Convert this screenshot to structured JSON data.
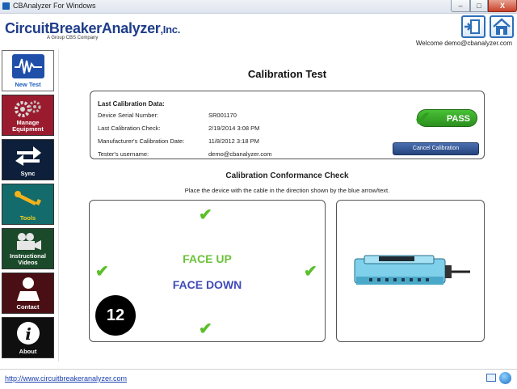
{
  "window": {
    "title": "CBAnalyzer For Windows",
    "minimize": "–",
    "maximize": "□",
    "close": "X"
  },
  "header": {
    "logo_main": "CircuitBreakerAnalyzer",
    "logo_suffix": ",Inc.",
    "tagline": "A Group CBS Company",
    "welcome": "Welcome demo@cbanalyzer.com",
    "exit_icon": "exit-door-icon",
    "home_icon": "home-icon"
  },
  "sidebar": {
    "items": [
      {
        "label": "New Test",
        "icon": "waveform-icon",
        "bg": "#ffffff",
        "fg": "#1f5fbf",
        "active": true
      },
      {
        "label": "Manage Equipment",
        "icon": "gears-icon",
        "bg": "#9b1b2e",
        "fg": "#ffffff"
      },
      {
        "label": "Sync",
        "icon": "sync-arrows-icon",
        "bg": "#0d1f3a",
        "fg": "#ffffff"
      },
      {
        "label": "Tools",
        "icon": "wrench-icon",
        "bg": "#146b6b",
        "fg": "#f2d21b"
      },
      {
        "label": "Instructional Videos",
        "icon": "video-camera-icon",
        "bg": "#1b4a2a",
        "fg": "#ffffff"
      },
      {
        "label": "Contact",
        "icon": "person-icon",
        "bg": "#4a0f14",
        "fg": "#ffffff"
      },
      {
        "label": "About",
        "icon": "info-icon",
        "bg": "#0f0f0f",
        "fg": "#ffffff"
      }
    ]
  },
  "main": {
    "title": "Calibration Test",
    "last_calibration": {
      "heading": "Last Calibration Data:",
      "rows": [
        {
          "label": "Device Serial Number:",
          "value": "SR001170"
        },
        {
          "label": "Last Calibration Check:",
          "value": "2/19/2014 3:08 PM"
        },
        {
          "label": "Manufacturer's Calibration Date:",
          "value": "11/8/2012 3:18 PM"
        },
        {
          "label": "Tester's username:",
          "value": "demo@cbanalyzer.com"
        }
      ],
      "status": "PASS",
      "cancel_label": "Cancel Calibration"
    },
    "conformance": {
      "title": "Calibration Conformance Check",
      "instruction": "Place the device with the cable in the direction shown by the blue arrow/text.",
      "face_up": "FACE UP",
      "face_down": "FACE DOWN",
      "counter": "12"
    }
  },
  "status_bar": {
    "url": "http://www.circuitbreakeranalyzer.com"
  },
  "colors": {
    "brand_blue": "#1f3d8a",
    "pass_green": "#2f9e1e",
    "face_up_green": "#6cc23a",
    "face_down_blue": "#3f4bb8",
    "check_green": "#5bbf2a"
  }
}
